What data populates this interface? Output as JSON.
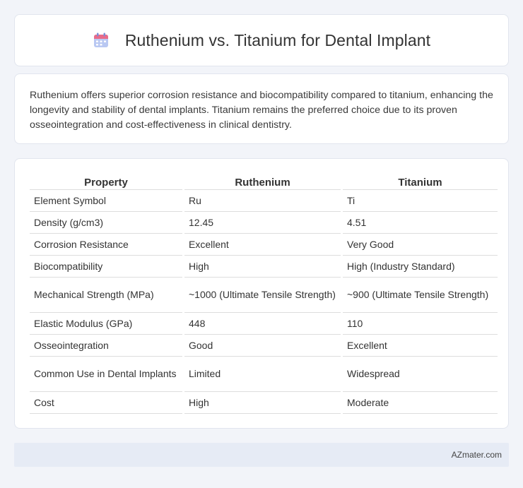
{
  "header": {
    "icon": "calendar-icon",
    "title": "Ruthenium vs. Titanium for Dental Implant"
  },
  "summary": {
    "text": "Ruthenium offers superior corrosion resistance and biocompatibility compared to titanium, enhancing the longevity and stability of dental implants. Titanium remains the preferred choice due to its proven osseointegration and cost-effectiveness in clinical dentistry."
  },
  "table": {
    "headers": [
      "Property",
      "Ruthenium",
      "Titanium"
    ],
    "rows": [
      [
        "Element Symbol",
        "Ru",
        "Ti"
      ],
      [
        "Density (g/cm3)",
        "12.45",
        "4.51"
      ],
      [
        "Corrosion Resistance",
        "Excellent",
        "Very Good"
      ],
      [
        "Biocompatibility",
        "High",
        "High (Industry Standard)"
      ],
      [
        "Mechanical Strength (MPa)",
        "~1000 (Ultimate Tensile Strength)",
        "~900 (Ultimate Tensile Strength)"
      ],
      [
        "Elastic Modulus (GPa)",
        "448",
        "110"
      ],
      [
        "Osseointegration",
        "Good",
        "Excellent"
      ],
      [
        "Common Use in Dental Implants",
        "Limited",
        "Widespread"
      ],
      [
        "Cost",
        "High",
        "Moderate"
      ]
    ]
  },
  "footer": {
    "text": "AZmater.com"
  },
  "colors": {
    "background": "#f2f4f9",
    "card": "#ffffff",
    "footer_bg": "#e6ebf5",
    "icon_accent": "#e86b8a",
    "icon_body": "#8aa4e6"
  }
}
